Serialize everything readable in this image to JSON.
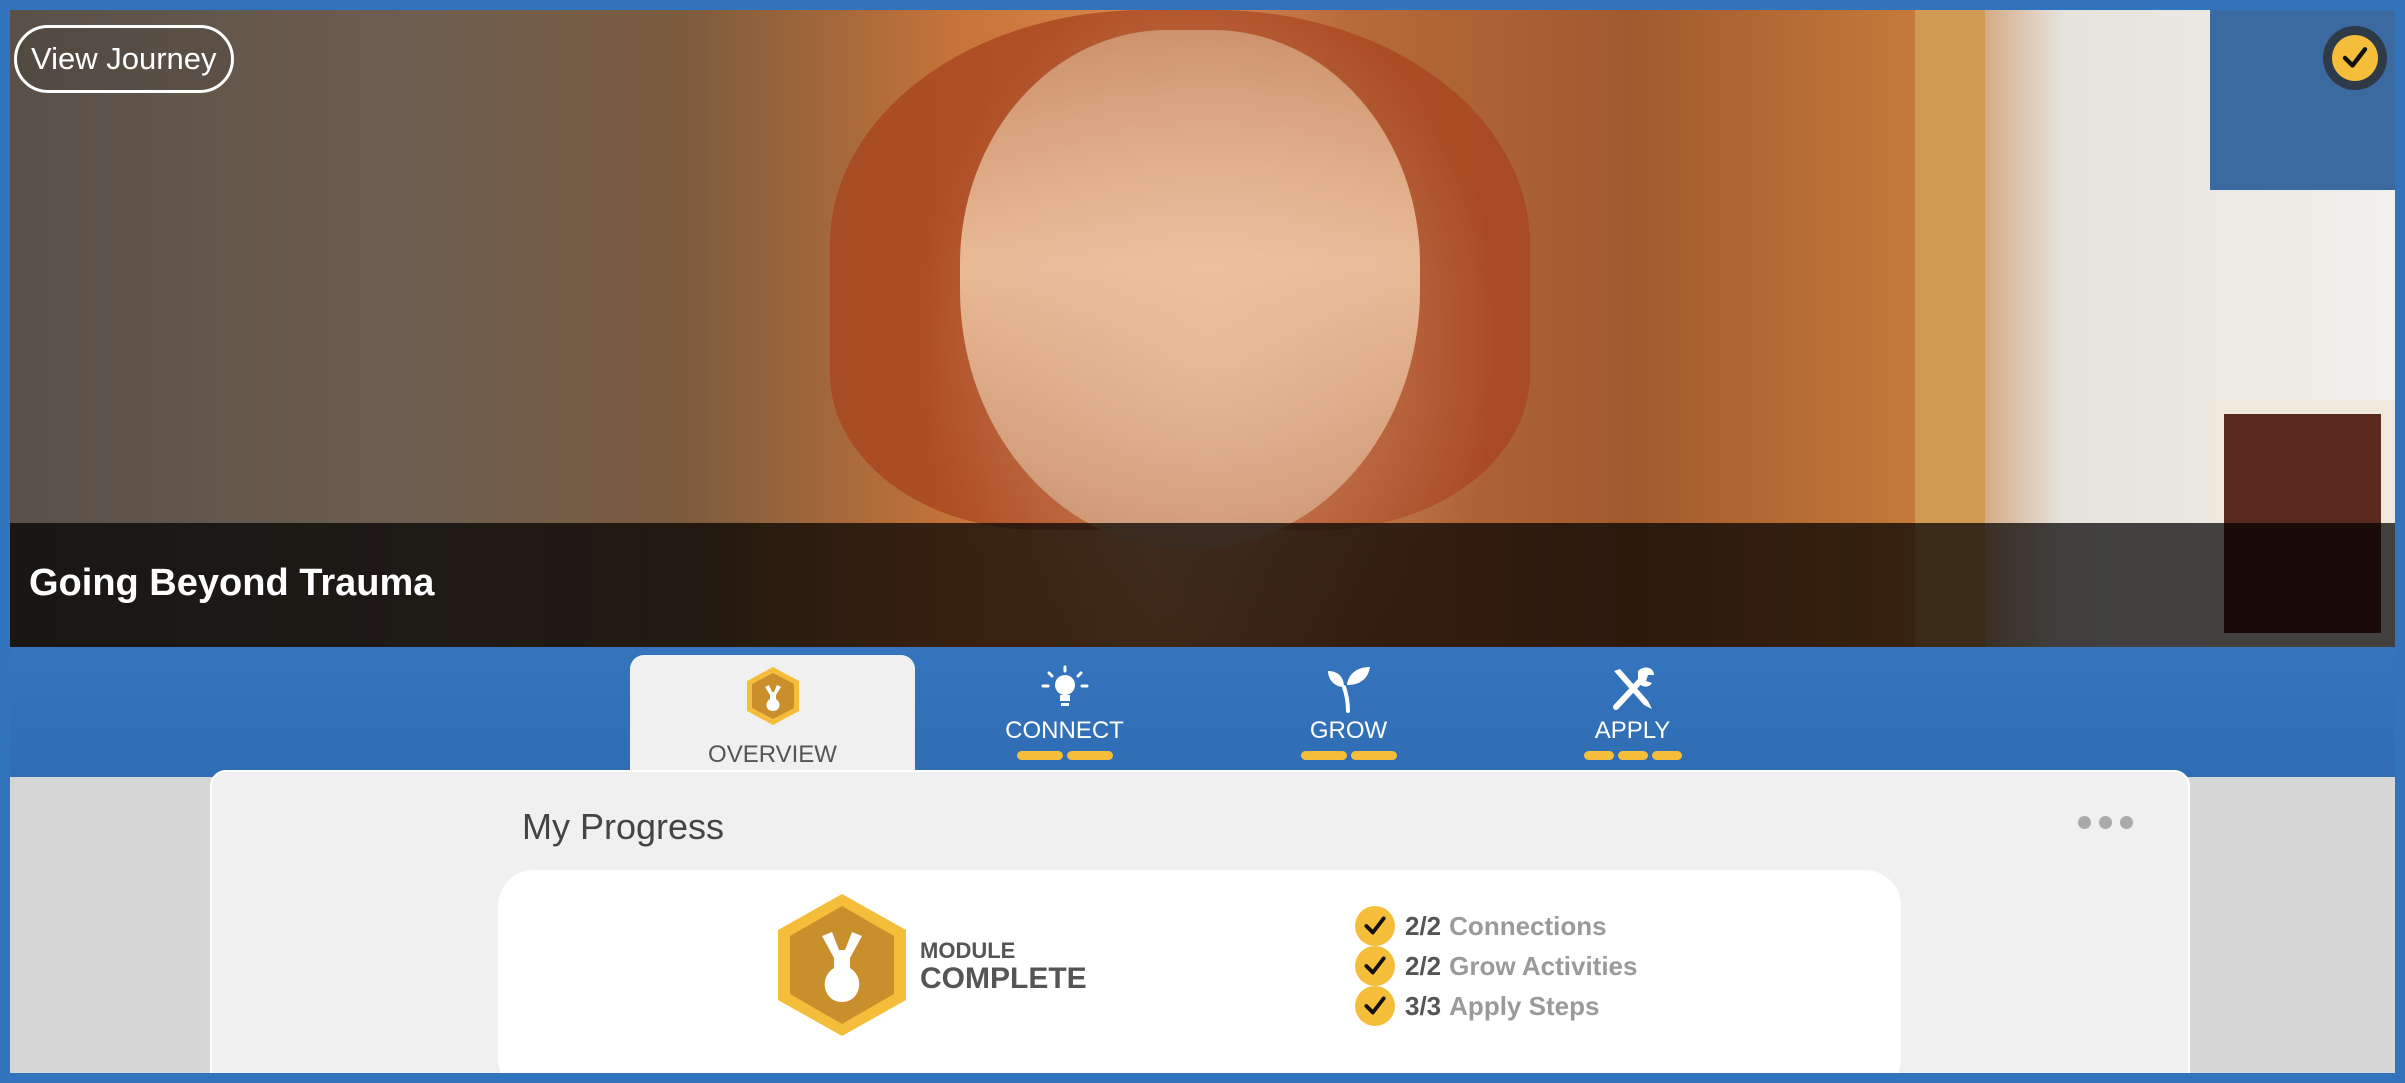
{
  "hero": {
    "title": "Going Beyond Trauma",
    "view_journey_label": "View Journey",
    "completed_icon": "check-circle-icon"
  },
  "tabs": [
    {
      "label": "OVERVIEW",
      "icon": "module-hex-icon",
      "active": true,
      "segments": 0
    },
    {
      "label": "CONNECT",
      "icon": "lightbulb-icon",
      "active": false,
      "segments": 2
    },
    {
      "label": "GROW",
      "icon": "sprout-icon",
      "active": false,
      "segments": 2
    },
    {
      "label": "APPLY",
      "icon": "tools-icon",
      "active": false,
      "segments": 3
    }
  ],
  "progress": {
    "title": "My Progress",
    "more_icon": "more-dots-icon",
    "module_line1": "MODULE",
    "module_line2": "COMPLETE",
    "stats": [
      {
        "count": "2/2",
        "label": "Connections"
      },
      {
        "count": "2/2",
        "label": "Grow Activities"
      },
      {
        "count": "3/3",
        "label": "Apply Steps"
      }
    ]
  },
  "colors": {
    "brand_blue": "#3273bd",
    "accent_gold": "#f5be3a",
    "badge_gold": "#c98f2c"
  }
}
